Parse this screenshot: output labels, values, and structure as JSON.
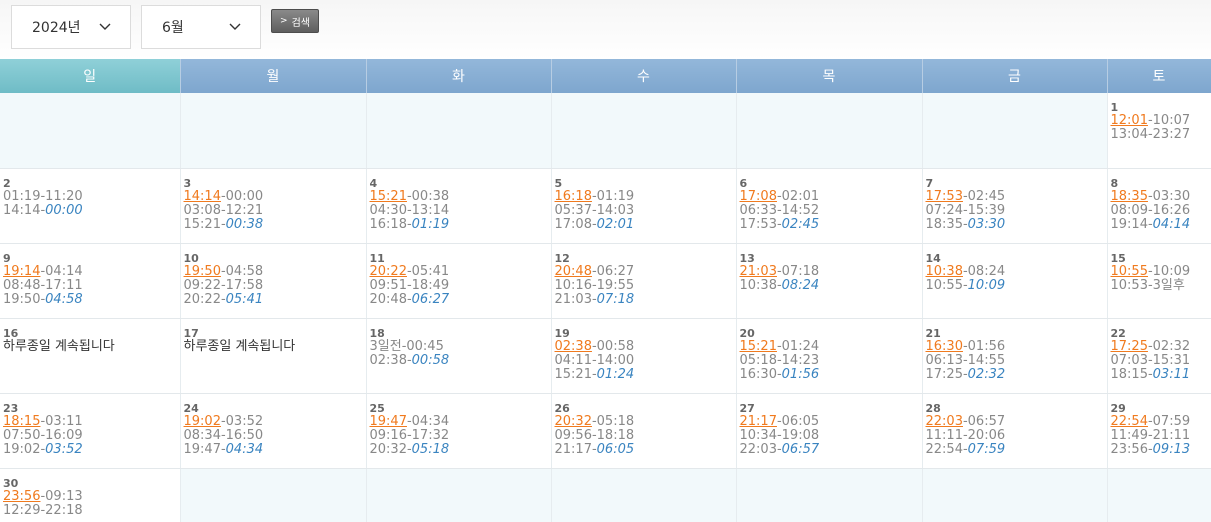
{
  "controls": {
    "year": "2024년",
    "month": "6월",
    "search_label": "검색",
    "search_arrow": ">"
  },
  "weekdays": [
    "일",
    "월",
    "화",
    "수",
    "목",
    "금",
    "토"
  ],
  "colors": {
    "sunday_header": "#6fbcc6",
    "weekday_header": "#7ea6ce",
    "highlight_time": "#f07a1e",
    "italic_time": "#3a84c0",
    "empty_cell": "#f2f9fb"
  },
  "weeks": [
    [
      null,
      null,
      null,
      null,
      null,
      null,
      {
        "day": "1",
        "lines": [
          [
            {
              "t": "12:01",
              "s": "rise"
            },
            {
              "t": "-10:07"
            }
          ],
          [
            {
              "t": "13:04-23:27"
            }
          ]
        ]
      }
    ],
    [
      {
        "day": "2",
        "lines": [
          [
            {
              "t": "01:19-11:20"
            }
          ],
          [
            {
              "t": "14:14-"
            },
            {
              "t": "00:00",
              "s": "ital"
            }
          ]
        ]
      },
      {
        "day": "3",
        "lines": [
          [
            {
              "t": "14:14",
              "s": "rise"
            },
            {
              "t": "-00:00"
            }
          ],
          [
            {
              "t": "03:08-12:21"
            }
          ],
          [
            {
              "t": "15:21-"
            },
            {
              "t": "00:38",
              "s": "ital"
            }
          ]
        ]
      },
      {
        "day": "4",
        "lines": [
          [
            {
              "t": "15:21",
              "s": "rise"
            },
            {
              "t": "-00:38"
            }
          ],
          [
            {
              "t": "04:30-13:14"
            }
          ],
          [
            {
              "t": "16:18-"
            },
            {
              "t": "01:19",
              "s": "ital"
            }
          ]
        ]
      },
      {
        "day": "5",
        "lines": [
          [
            {
              "t": "16:18",
              "s": "rise"
            },
            {
              "t": "-01:19"
            }
          ],
          [
            {
              "t": "05:37-14:03"
            }
          ],
          [
            {
              "t": "17:08-"
            },
            {
              "t": "02:01",
              "s": "ital"
            }
          ]
        ]
      },
      {
        "day": "6",
        "lines": [
          [
            {
              "t": "17:08",
              "s": "rise"
            },
            {
              "t": "-02:01"
            }
          ],
          [
            {
              "t": "06:33-14:52"
            }
          ],
          [
            {
              "t": "17:53-"
            },
            {
              "t": "02:45",
              "s": "ital"
            }
          ]
        ]
      },
      {
        "day": "7",
        "lines": [
          [
            {
              "t": "17:53",
              "s": "rise"
            },
            {
              "t": "-02:45"
            }
          ],
          [
            {
              "t": "07:24-15:39"
            }
          ],
          [
            {
              "t": "18:35-"
            },
            {
              "t": "03:30",
              "s": "ital"
            }
          ]
        ]
      },
      {
        "day": "8",
        "lines": [
          [
            {
              "t": "18:35",
              "s": "rise"
            },
            {
              "t": "-03:30"
            }
          ],
          [
            {
              "t": "08:09-16:26"
            }
          ],
          [
            {
              "t": "19:14-"
            },
            {
              "t": "04:14",
              "s": "ital"
            }
          ]
        ]
      }
    ],
    [
      {
        "day": "9",
        "lines": [
          [
            {
              "t": "19:14",
              "s": "rise"
            },
            {
              "t": "-04:14"
            }
          ],
          [
            {
              "t": "08:48-17:11"
            }
          ],
          [
            {
              "t": "19:50-"
            },
            {
              "t": "04:58",
              "s": "ital"
            }
          ]
        ]
      },
      {
        "day": "10",
        "lines": [
          [
            {
              "t": "19:50",
              "s": "rise"
            },
            {
              "t": "-04:58"
            }
          ],
          [
            {
              "t": "09:22-17:58"
            }
          ],
          [
            {
              "t": "20:22-"
            },
            {
              "t": "05:41",
              "s": "ital"
            }
          ]
        ]
      },
      {
        "day": "11",
        "lines": [
          [
            {
              "t": "20:22",
              "s": "rise"
            },
            {
              "t": "-05:41"
            }
          ],
          [
            {
              "t": "09:51-18:49"
            }
          ],
          [
            {
              "t": "20:48-"
            },
            {
              "t": "06:27",
              "s": "ital"
            }
          ]
        ]
      },
      {
        "day": "12",
        "lines": [
          [
            {
              "t": "20:48",
              "s": "rise"
            },
            {
              "t": "-06:27"
            }
          ],
          [
            {
              "t": "10:16-19:55"
            }
          ],
          [
            {
              "t": "21:03-"
            },
            {
              "t": "07:18",
              "s": "ital"
            }
          ]
        ]
      },
      {
        "day": "13",
        "lines": [
          [
            {
              "t": "21:03",
              "s": "rise"
            },
            {
              "t": "-07:18"
            }
          ],
          [
            {
              "t": "10:38-"
            },
            {
              "t": "08:24",
              "s": "ital"
            }
          ]
        ]
      },
      {
        "day": "14",
        "lines": [
          [
            {
              "t": "10:38",
              "s": "rise"
            },
            {
              "t": "-08:24"
            }
          ],
          [
            {
              "t": "10:55-"
            },
            {
              "t": "10:09",
              "s": "ital"
            }
          ]
        ]
      },
      {
        "day": "15",
        "lines": [
          [
            {
              "t": "10:55",
              "s": "rise"
            },
            {
              "t": "-10:09"
            }
          ],
          [
            {
              "t": "10:53-3일후"
            }
          ]
        ]
      }
    ],
    [
      {
        "day": "16",
        "lines": [
          [
            {
              "t": "하루종일 계속됩니다",
              "s": "allday"
            }
          ]
        ]
      },
      {
        "day": "17",
        "lines": [
          [
            {
              "t": "하루종일 계속됩니다",
              "s": "allday"
            }
          ]
        ]
      },
      {
        "day": "18",
        "lines": [
          [
            {
              "t": "3일전-00:45"
            }
          ],
          [
            {
              "t": "02:38-"
            },
            {
              "t": "00:58",
              "s": "ital"
            }
          ]
        ]
      },
      {
        "day": "19",
        "lines": [
          [
            {
              "t": "02:38",
              "s": "rise"
            },
            {
              "t": "-00:58"
            }
          ],
          [
            {
              "t": "04:11-14:00"
            }
          ],
          [
            {
              "t": "15:21-"
            },
            {
              "t": "01:24",
              "s": "ital"
            }
          ]
        ]
      },
      {
        "day": "20",
        "lines": [
          [
            {
              "t": "15:21",
              "s": "rise"
            },
            {
              "t": "-01:24"
            }
          ],
          [
            {
              "t": "05:18-14:23"
            }
          ],
          [
            {
              "t": "16:30-"
            },
            {
              "t": "01:56",
              "s": "ital"
            }
          ]
        ]
      },
      {
        "day": "21",
        "lines": [
          [
            {
              "t": "16:30",
              "s": "rise"
            },
            {
              "t": "-01:56"
            }
          ],
          [
            {
              "t": "06:13-14:55"
            }
          ],
          [
            {
              "t": "17:25-"
            },
            {
              "t": "02:32",
              "s": "ital"
            }
          ]
        ]
      },
      {
        "day": "22",
        "lines": [
          [
            {
              "t": "17:25",
              "s": "rise"
            },
            {
              "t": "-02:32"
            }
          ],
          [
            {
              "t": "07:03-15:31"
            }
          ],
          [
            {
              "t": "18:15-"
            },
            {
              "t": "03:11",
              "s": "ital"
            }
          ]
        ]
      }
    ],
    [
      {
        "day": "23",
        "lines": [
          [
            {
              "t": "18:15",
              "s": "rise"
            },
            {
              "t": "-03:11"
            }
          ],
          [
            {
              "t": "07:50-16:09"
            }
          ],
          [
            {
              "t": "19:02-"
            },
            {
              "t": "03:52",
              "s": "ital"
            }
          ]
        ]
      },
      {
        "day": "24",
        "lines": [
          [
            {
              "t": "19:02",
              "s": "rise"
            },
            {
              "t": "-03:52"
            }
          ],
          [
            {
              "t": "08:34-16:50"
            }
          ],
          [
            {
              "t": "19:47-"
            },
            {
              "t": "04:34",
              "s": "ital"
            }
          ]
        ]
      },
      {
        "day": "25",
        "lines": [
          [
            {
              "t": "19:47",
              "s": "rise"
            },
            {
              "t": "-04:34"
            }
          ],
          [
            {
              "t": "09:16-17:32"
            }
          ],
          [
            {
              "t": "20:32-"
            },
            {
              "t": "05:18",
              "s": "ital"
            }
          ]
        ]
      },
      {
        "day": "26",
        "lines": [
          [
            {
              "t": "20:32",
              "s": "rise"
            },
            {
              "t": "-05:18"
            }
          ],
          [
            {
              "t": "09:56-18:18"
            }
          ],
          [
            {
              "t": "21:17-"
            },
            {
              "t": "06:05",
              "s": "ital"
            }
          ]
        ]
      },
      {
        "day": "27",
        "lines": [
          [
            {
              "t": "21:17",
              "s": "rise"
            },
            {
              "t": "-06:05"
            }
          ],
          [
            {
              "t": "10:34-19:08"
            }
          ],
          [
            {
              "t": "22:03-"
            },
            {
              "t": "06:57",
              "s": "ital"
            }
          ]
        ]
      },
      {
        "day": "28",
        "lines": [
          [
            {
              "t": "22:03",
              "s": "rise"
            },
            {
              "t": "-06:57"
            }
          ],
          [
            {
              "t": "11:11-20:06"
            }
          ],
          [
            {
              "t": "22:54-"
            },
            {
              "t": "07:59",
              "s": "ital"
            }
          ]
        ]
      },
      {
        "day": "29",
        "lines": [
          [
            {
              "t": "22:54",
              "s": "rise"
            },
            {
              "t": "-07:59"
            }
          ],
          [
            {
              "t": "11:49-21:11"
            }
          ],
          [
            {
              "t": "23:56-"
            },
            {
              "t": "09:13",
              "s": "ital"
            }
          ]
        ]
      }
    ],
    [
      {
        "day": "30",
        "lines": [
          [
            {
              "t": "23:56",
              "s": "rise"
            },
            {
              "t": "-09:13"
            }
          ],
          [
            {
              "t": "12:29-22:18"
            }
          ]
        ]
      },
      null,
      null,
      null,
      null,
      null,
      null
    ]
  ]
}
